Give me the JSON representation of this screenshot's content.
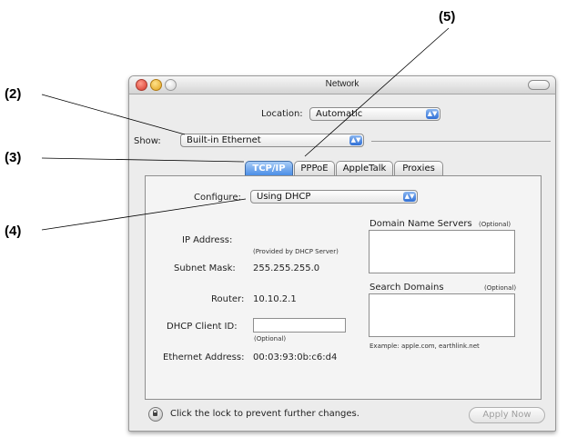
{
  "callouts": [
    "(2)",
    "(3)",
    "(4)",
    "(5)"
  ],
  "window": {
    "title": "Network"
  },
  "location": {
    "label": "Location:",
    "value": "Automatic"
  },
  "show": {
    "label": "Show:",
    "value": "Built-in Ethernet"
  },
  "tabs": [
    "TCP/IP",
    "PPPoE",
    "AppleTalk",
    "Proxies"
  ],
  "configure": {
    "label": "Configure:",
    "value": "Using DHCP"
  },
  "ip": {
    "label": "IP Address:",
    "note": "(Provided by DHCP Server)"
  },
  "subnet": {
    "label": "Subnet Mask:",
    "value": "255.255.255.0"
  },
  "router": {
    "label": "Router:",
    "value": "10.10.2.1"
  },
  "dhcp": {
    "label": "DHCP Client ID:",
    "note": "(Optional)",
    "value": ""
  },
  "ethernet": {
    "label": "Ethernet Address:",
    "value": "00:03:93:0b:c6:d4"
  },
  "dns": {
    "label": "Domain Name Servers",
    "optional": "(Optional)"
  },
  "search": {
    "label": "Search Domains",
    "optional": "(Optional)",
    "example": "Example: apple.com, earthlink.net"
  },
  "footer": {
    "lock_text": "Click the lock to prevent further changes.",
    "apply_label": "Apply Now"
  }
}
